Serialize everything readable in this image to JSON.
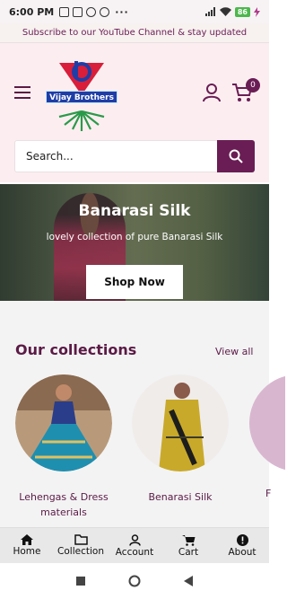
{
  "status_bar": {
    "time": "6:00 PM",
    "battery": "86"
  },
  "announcement": {
    "text": "Subscribe to our YouTube Channel & stay updated"
  },
  "header": {
    "logo_text": "Vijay Brothers",
    "cart_count": "0"
  },
  "search": {
    "placeholder": "Search..."
  },
  "hero": {
    "title": "Banarasi Silk",
    "subtitle": "lovely collection of pure Banarasi Silk",
    "button_label": "Shop Now"
  },
  "collections": {
    "title": "Our collections",
    "view_all_label": "View all",
    "items": [
      {
        "label": "Lehengas & Dress materials"
      },
      {
        "label": "Benarasi Silk"
      },
      {
        "label": "F"
      }
    ]
  },
  "bottom_nav": {
    "items": [
      {
        "label": "Home",
        "icon": "home-icon"
      },
      {
        "label": "Collection",
        "icon": "folder-icon"
      },
      {
        "label": "Account",
        "icon": "user-icon"
      },
      {
        "label": "Cart",
        "icon": "cart-icon"
      },
      {
        "label": "About",
        "icon": "info-icon"
      }
    ]
  },
  "colors": {
    "brand": "#6a1d55",
    "header_bg": "#fceef0",
    "collections_bg": "#f3f3f4"
  }
}
